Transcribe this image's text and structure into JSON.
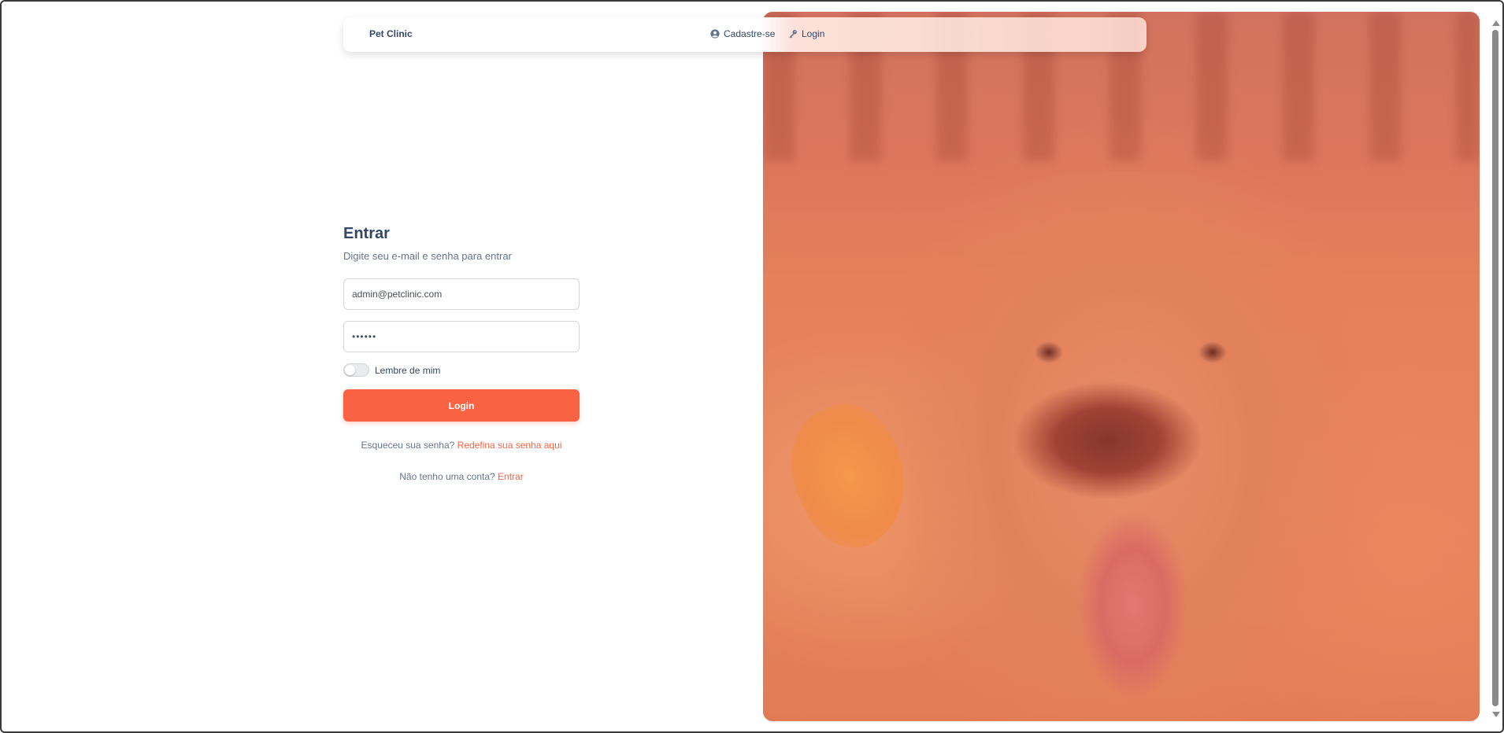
{
  "navbar": {
    "brand": "Pet Clinic",
    "links": [
      {
        "label": "Cadastre-se",
        "icon": "user-circle-icon"
      },
      {
        "label": "Login",
        "icon": "key-icon"
      }
    ]
  },
  "form": {
    "title": "Entrar",
    "subtitle": "Digite seu e-mail e senha para entrar",
    "email_value": "admin@petclinic.com",
    "password_value": "••••••",
    "remember_label": "Lembre de mim",
    "remember_checked": false,
    "submit_label": "Login",
    "forgot_text": "Esqueceu sua senha?",
    "forgot_link": "Redefina sua senha aqui",
    "account_text": "Não tenho uma conta?",
    "account_link": "Entrar"
  },
  "hero": {
    "image": "golden-retriever-autumn-leaves",
    "tint": "#f96343"
  },
  "colors": {
    "accent": "#f96343",
    "text_dark": "#344767",
    "text_muted": "#67748e"
  }
}
